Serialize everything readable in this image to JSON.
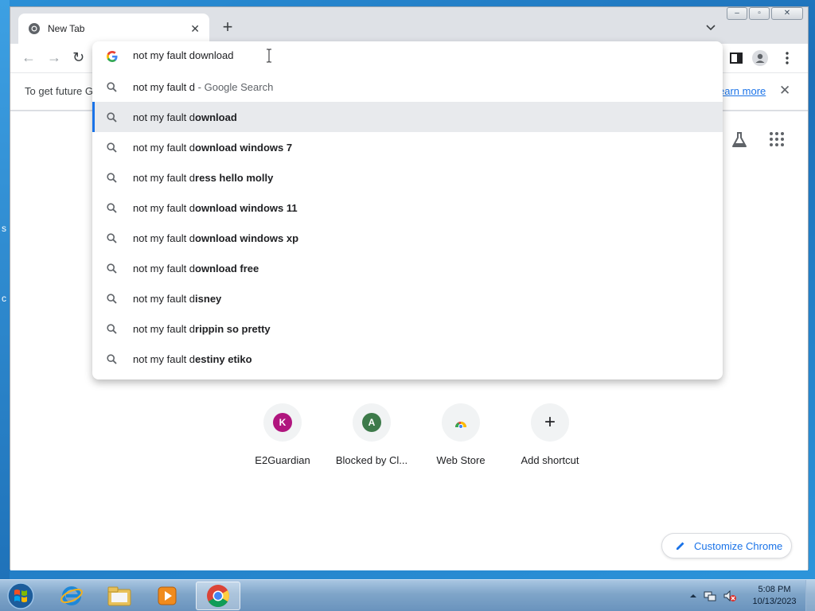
{
  "desktop": {
    "edge_glyphs": [
      "s",
      "c"
    ]
  },
  "window": {
    "tab": {
      "title": "New Tab",
      "close_glyph": "✕"
    },
    "new_tab_glyph": "+",
    "tab_list_glyph": "⌄",
    "controls": {
      "minimize": "–",
      "maximize": "▫",
      "close": "✕"
    }
  },
  "toolbar": {
    "back": "←",
    "forward": "→",
    "reload": "↻"
  },
  "infobar": {
    "message": "To get future G",
    "learn_more": "earn more",
    "close": "✕"
  },
  "omnibox": {
    "input": "not my fault download",
    "suggestions": [
      {
        "typed": "not my fault d",
        "completion": "",
        "hint": " - Google Search",
        "selected": false
      },
      {
        "typed": "not my fault d",
        "completion": "ownload",
        "hint": "",
        "selected": true
      },
      {
        "typed": "not my fault d",
        "completion": "ownload windows 7",
        "hint": "",
        "selected": false
      },
      {
        "typed": "not my fault d",
        "completion": "ress hello molly",
        "hint": "",
        "selected": false
      },
      {
        "typed": "not my fault d",
        "completion": "ownload windows 11",
        "hint": "",
        "selected": false
      },
      {
        "typed": "not my fault d",
        "completion": "ownload windows xp",
        "hint": "",
        "selected": false
      },
      {
        "typed": "not my fault d",
        "completion": "ownload free",
        "hint": "",
        "selected": false
      },
      {
        "typed": "not my fault d",
        "completion": "isney",
        "hint": "",
        "selected": false
      },
      {
        "typed": "not my fault d",
        "completion": "rippin so pretty",
        "hint": "",
        "selected": false
      },
      {
        "typed": "not my fault d",
        "completion": "estiny etiko",
        "hint": "",
        "selected": false
      }
    ]
  },
  "shortcuts": [
    {
      "label": "E2Guardian",
      "letter": "K",
      "color": "#b0157e",
      "kind": "letter"
    },
    {
      "label": "Blocked by Cl...",
      "letter": "A",
      "color": "#3d7a4a",
      "kind": "letter"
    },
    {
      "label": "Web Store",
      "letter": "",
      "color": "",
      "kind": "webstore"
    },
    {
      "label": "Add shortcut",
      "letter": "+",
      "color": "",
      "kind": "add"
    }
  ],
  "customize": {
    "label": "Customize Chrome"
  },
  "taskbar": {
    "clock_time": "5:08 PM",
    "clock_date": "10/13/2023",
    "apps": [
      "internet-explorer",
      "file-explorer",
      "media-player",
      "chrome"
    ]
  },
  "colors": {
    "accent": "#1a73e8",
    "selected_row": "#e8eaed"
  }
}
